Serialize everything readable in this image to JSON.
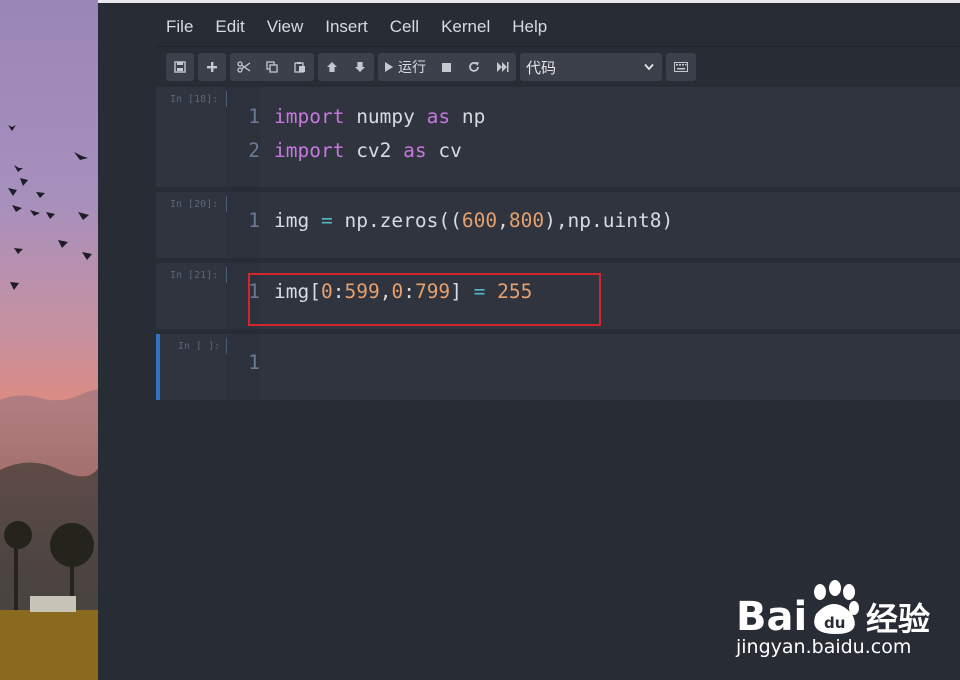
{
  "menu": [
    "File",
    "Edit",
    "View",
    "Insert",
    "Cell",
    "Kernel",
    "Help"
  ],
  "toolbar": {
    "run_label": "运行",
    "cell_type": "代码"
  },
  "cells": [
    {
      "prompt": "In [18]:",
      "lines": [
        "1",
        "2"
      ]
    },
    {
      "prompt": "In [20]:",
      "lines": [
        "1"
      ]
    },
    {
      "prompt": "In [21]:",
      "lines": [
        "1"
      ]
    },
    {
      "prompt": "In [ ]:",
      "lines": [
        "1"
      ]
    }
  ],
  "code": {
    "c1l1": {
      "kw1": "import",
      "t1": " numpy ",
      "kw2": "as",
      "t2": " np"
    },
    "c1l2": {
      "kw1": "import",
      "t1": " cv2 ",
      "kw2": "as",
      "t2": " cv"
    },
    "c2l1": {
      "a": "img ",
      "op": "=",
      "b": " np.zeros((",
      "n1": "600",
      "c": ",",
      "n2": "800",
      "d": "),np.uint8)"
    },
    "c3l1": {
      "a": "img[",
      "n1": "0",
      "b": ":",
      "n2": "599",
      "c": ",",
      "n3": "0",
      "d": ":",
      "n4": "799",
      "e": "] ",
      "op": "=",
      "f": " ",
      "n5": "255"
    }
  },
  "watermark": {
    "brand_left": "Bai",
    "brand_right": "经验",
    "url": "jingyan.baidu.com"
  },
  "colors": {
    "background": "#282c34",
    "cell": "#2f343f",
    "keyword": "#c678dd",
    "number": "#e5a06e",
    "operator": "#56b6c2",
    "selected_border": "#2e74c0",
    "highlight": "#d1262c"
  }
}
